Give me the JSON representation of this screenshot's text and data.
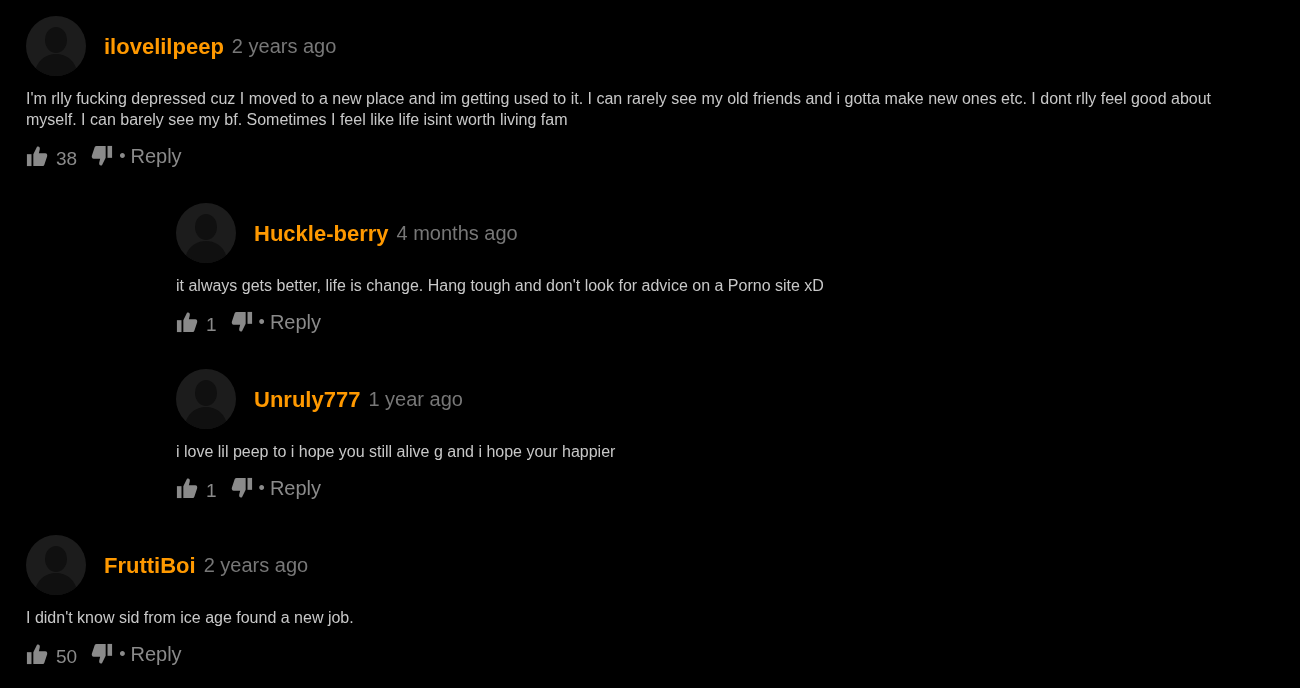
{
  "comments": [
    {
      "author": "ilovelilpeep",
      "time": "2 years ago",
      "text": "I'm rlly fucking depressed cuz I moved to a new place and im getting used to it. I can rarely see my old friends and i gotta make new ones etc. I dont rlly feel good about myself. I can barely see my bf. Sometimes I feel like life isint worth living fam",
      "likes": "38",
      "separator": "•",
      "reply": "Reply",
      "children": [
        {
          "author": "Huckle-berry",
          "time": "4 months ago",
          "text": "it always gets better, life is change. Hang tough and don't look for advice on a Porno site xD",
          "likes": "1",
          "separator": "•",
          "reply": "Reply"
        },
        {
          "author": "Unruly777",
          "time": "1 year ago",
          "text": "i love lil peep to i hope you still alive g and i hope your happier",
          "likes": "1",
          "separator": "•",
          "reply": "Reply"
        }
      ]
    },
    {
      "author": "FruttiBoi",
      "time": "2 years ago",
      "text": "I didn't know sid from ice age found a new job.",
      "likes": "50",
      "separator": "•",
      "reply": "Reply"
    }
  ]
}
